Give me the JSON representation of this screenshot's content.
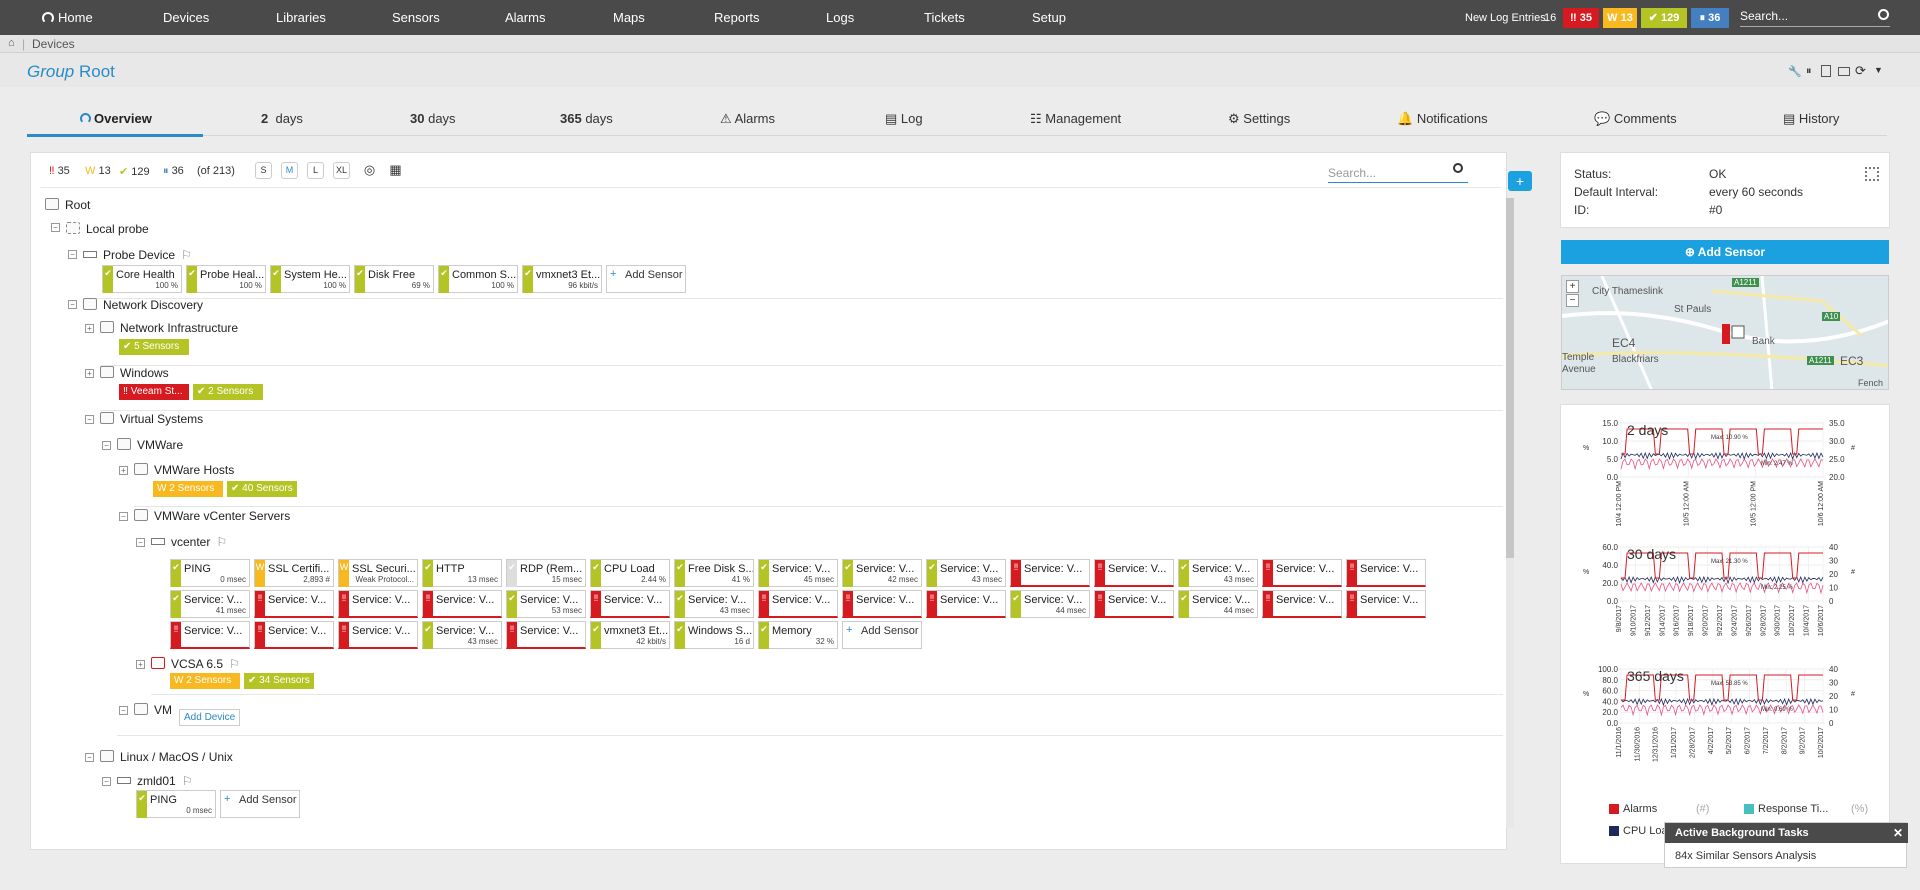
{
  "topnav": {
    "items": [
      "Home",
      "Devices",
      "Libraries",
      "Sensors",
      "Alarms",
      "Maps",
      "Reports",
      "Logs",
      "Tickets",
      "Setup"
    ],
    "new_log_label": "New Log Entries",
    "new_log_count": "16",
    "counts": {
      "red": "35",
      "yellow": "13",
      "green": "129",
      "blue": "36"
    },
    "search_placeholder": "Search..."
  },
  "breadcrumb": {
    "item": "Devices"
  },
  "page": {
    "title_italic": "Group",
    "title": "Root"
  },
  "tabs": [
    {
      "label": "Overview"
    },
    {
      "num": "2",
      "label": "days"
    },
    {
      "num": "30",
      "label": "days"
    },
    {
      "num": "365",
      "label": "days"
    },
    {
      "label": "Alarms"
    },
    {
      "label": "Log"
    },
    {
      "label": "Management"
    },
    {
      "label": "Settings"
    },
    {
      "label": "Notifications"
    },
    {
      "label": "Comments"
    },
    {
      "label": "History"
    }
  ],
  "toolbar": {
    "red": "35",
    "yellow": "13",
    "green": "129",
    "blue": "36",
    "total": "(of 213)",
    "sizes": [
      "S",
      "M",
      "L",
      "XL"
    ],
    "search_placeholder": "Search..."
  },
  "tree": {
    "root": "Root",
    "local_probe": "Local probe",
    "probe_device": "Probe Device",
    "network_discovery": "Network Discovery",
    "network_infrastructure": "Network Infrastructure",
    "windows": "Windows",
    "virtual_systems": "Virtual Systems",
    "vmware": "VMWare",
    "vmware_hosts": "VMWare Hosts",
    "vmware_vcenter": "VMWare vCenter Servers",
    "vcenter": "vcenter",
    "vcsa": "VCSA 6.5",
    "vm": "VM",
    "linux": "Linux / MacOS / Unix",
    "zmld01": "zmld01",
    "add_sensor": "Add Sensor",
    "add_device": "Add Device"
  },
  "probe_sensors": [
    {
      "name": "Core Health",
      "value": "100 %",
      "status": "g"
    },
    {
      "name": "Probe Heal...",
      "value": "100 %",
      "status": "g"
    },
    {
      "name": "System He...",
      "value": "100 %",
      "status": "g"
    },
    {
      "name": "Disk Free",
      "value": "69 %",
      "status": "g"
    },
    {
      "name": "Common S...",
      "value": "100 %",
      "status": "g"
    },
    {
      "name": "vmxnet3 Et...",
      "value": "96 kbit/s",
      "status": "g"
    }
  ],
  "badges": {
    "net_infra": "5 Sensors",
    "win_red": "Veeam St...",
    "win_green": "2 Sensors",
    "hosts_yellow": "2 Sensors",
    "hosts_green": "40 Sensors",
    "vcsa_yellow": "2 Sensors",
    "vcsa_green": "34 Sensors"
  },
  "vcenter_sensors": [
    {
      "name": "PING",
      "value": "0 msec",
      "status": "g"
    },
    {
      "name": "SSL Certifi...",
      "value": "2,893 #",
      "status": "y"
    },
    {
      "name": "SSL Securi...",
      "value": "Weak Protocol...",
      "status": "y"
    },
    {
      "name": "HTTP",
      "value": "13 msec",
      "status": "g"
    },
    {
      "name": "RDP (Rem...",
      "value": "15 msec",
      "status": "gr"
    },
    {
      "name": "CPU Load",
      "value": "2.44 %",
      "status": "g"
    },
    {
      "name": "Free Disk S...",
      "value": "41 %",
      "status": "g"
    },
    {
      "name": "Service: V...",
      "value": "45 msec",
      "status": "g"
    },
    {
      "name": "Service: V...",
      "value": "42 msec",
      "status": "g"
    },
    {
      "name": "Service: V...",
      "value": "43 msec",
      "status": "g"
    },
    {
      "name": "Service: V...",
      "value": "",
      "status": "r"
    },
    {
      "name": "Service: V...",
      "value": "",
      "status": "r"
    },
    {
      "name": "Service: V...",
      "value": "43 msec",
      "status": "g"
    },
    {
      "name": "Service: V...",
      "value": "",
      "status": "r"
    },
    {
      "name": "Service: V...",
      "value": "",
      "status": "r"
    },
    {
      "name": "Service: V...",
      "value": "41 msec",
      "status": "g"
    },
    {
      "name": "Service: V...",
      "value": "",
      "status": "r"
    },
    {
      "name": "Service: V...",
      "value": "",
      "status": "r"
    },
    {
      "name": "Service: V...",
      "value": "",
      "status": "r"
    },
    {
      "name": "Service: V...",
      "value": "53 msec",
      "status": "g"
    },
    {
      "name": "Service: V...",
      "value": "",
      "status": "r"
    },
    {
      "name": "Service: V...",
      "value": "43 msec",
      "status": "g"
    },
    {
      "name": "Service: V...",
      "value": "",
      "status": "r"
    },
    {
      "name": "Service: V...",
      "value": "",
      "status": "r"
    },
    {
      "name": "Service: V...",
      "value": "",
      "status": "r"
    },
    {
      "name": "Service: V...",
      "value": "44 msec",
      "status": "g"
    },
    {
      "name": "Service: V...",
      "value": "",
      "status": "r"
    },
    {
      "name": "Service: V...",
      "value": "44 msec",
      "status": "g"
    },
    {
      "name": "Service: V...",
      "value": "",
      "status": "r"
    },
    {
      "name": "Service: V...",
      "value": "",
      "status": "r"
    },
    {
      "name": "Service: V...",
      "value": "",
      "status": "r"
    },
    {
      "name": "Service: V...",
      "value": "",
      "status": "r"
    },
    {
      "name": "Service: V...",
      "value": "",
      "status": "r"
    },
    {
      "name": "Service: V...",
      "value": "43 msec",
      "status": "g"
    },
    {
      "name": "Service: V...",
      "value": "",
      "status": "r"
    },
    {
      "name": "vmxnet3 Et...",
      "value": "42 kbit/s",
      "status": "g"
    },
    {
      "name": "Windows S...",
      "value": "16 d",
      "status": "g"
    },
    {
      "name": "Memory",
      "value": "32 %",
      "status": "g"
    }
  ],
  "zmld_sensors": [
    {
      "name": "PING",
      "value": "0 msec",
      "status": "g"
    }
  ],
  "details": {
    "status_label": "Status:",
    "status_value": "OK",
    "interval_label": "Default Interval:",
    "interval_value": "every  60 seconds",
    "id_label": "ID:",
    "id_value": "#0",
    "add_sensor": "Add Sensor"
  },
  "map_labels": [
    "City Thameslink",
    "St Pauls",
    "EC4",
    "Bank",
    "Blackfriars",
    "Temple",
    "Avenue",
    "EC3",
    "A1211",
    "A10",
    "A1211",
    "Fench"
  ],
  "charts": [
    {
      "label": "2 days",
      "max": "Max: 10.90 %",
      "min": "Min: 2.47 %",
      "yleft": [
        "15.0",
        "10.0",
        "5.0",
        "0.0"
      ],
      "yright": [
        "35.0",
        "30.0",
        "25.0",
        "20.0"
      ],
      "x": [
        "10/4 12:00 PM",
        "10/5 12:00 AM",
        "10/5 12:00 PM",
        "10/6 12:00 AM"
      ]
    },
    {
      "label": "30 days",
      "max": "Max: 21.30 %",
      "min": "Min: 2.25 %",
      "yleft": [
        "60.0",
        "40.0",
        "20.0",
        "0.0"
      ],
      "yright": [
        "40",
        "30",
        "20",
        "10",
        "0"
      ],
      "x": [
        "9/8/2017",
        "9/10/2017",
        "9/12/2017",
        "9/14/2017",
        "9/16/2017",
        "9/18/2017",
        "9/20/2017",
        "9/22/2017",
        "9/24/2017",
        "9/26/2017",
        "9/28/2017",
        "9/30/2017",
        "10/2/2017",
        "10/4/2017",
        "10/6/2017"
      ]
    },
    {
      "label": "365 days",
      "max": "Max: 53.85 %",
      "min": "Min: 0.69 %",
      "yleft": [
        "100.0",
        "80.0",
        "60.0",
        "40.0",
        "20.0",
        "0.0"
      ],
      "yright": [
        "40",
        "30",
        "20",
        "10",
        "0"
      ],
      "x": [
        "11/1/2016",
        "11/30/2016",
        "12/31/2016",
        "1/31/2017",
        "2/28/2017",
        "4/2/2017",
        "5/2/2017",
        "6/2/2017",
        "7/2/2017",
        "8/2/2017",
        "9/2/2017",
        "10/2/2017"
      ]
    }
  ],
  "chart_legend": {
    "alarms": "Alarms",
    "alarms_unit": "(#)",
    "response": "Response Ti...",
    "response_unit": "(%)",
    "cpu": "CPU Loa..."
  },
  "bg_tasks": {
    "title": "Active Background Tasks",
    "body": "84x Similar Sensors Analysis"
  },
  "colors": {
    "accent": "#2a8bc8",
    "red": "#d71920",
    "yellow": "#f8b820",
    "green": "#b4c424",
    "blue": "#447fc1",
    "topbar": "#4a4a4a"
  }
}
